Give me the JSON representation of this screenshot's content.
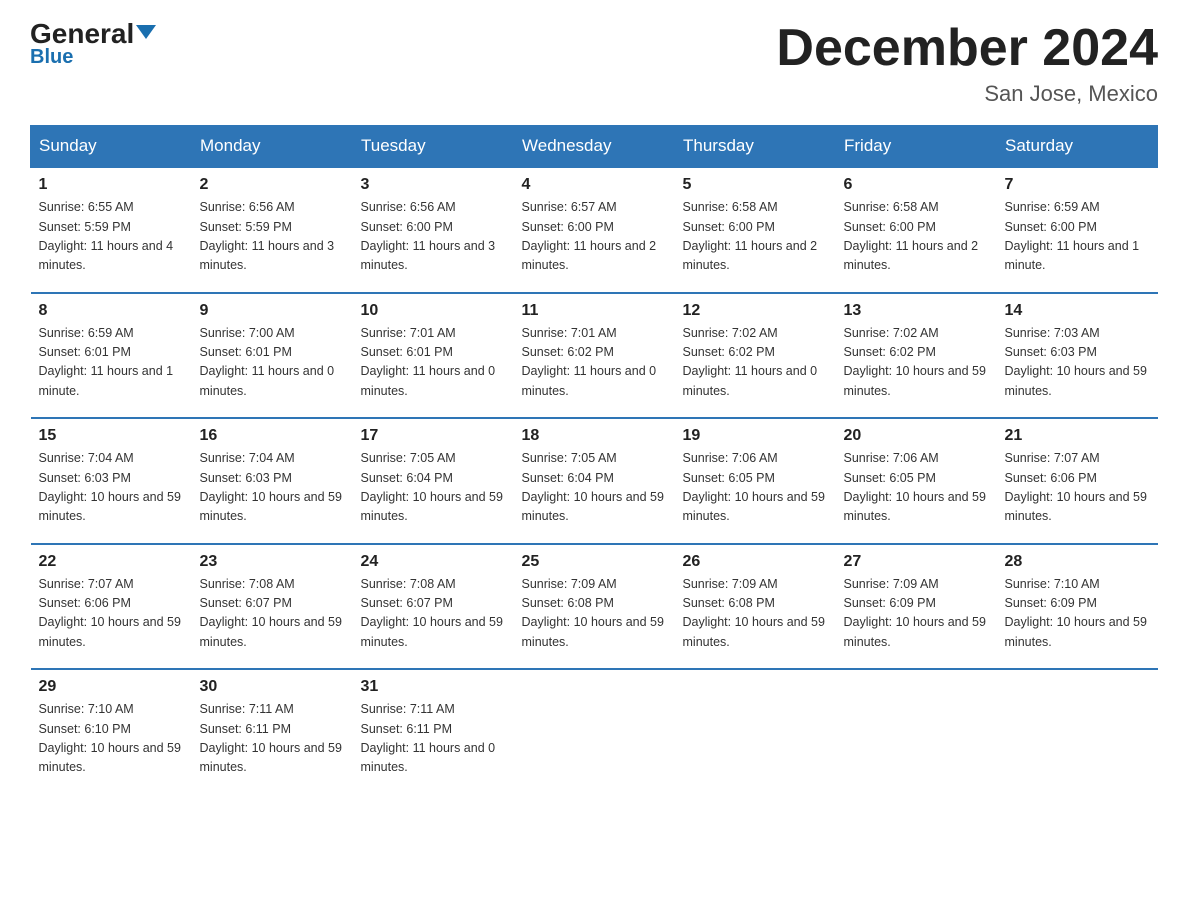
{
  "header": {
    "logo_general": "General",
    "logo_blue": "Blue",
    "month_title": "December 2024",
    "location": "San Jose, Mexico"
  },
  "weekdays": [
    "Sunday",
    "Monday",
    "Tuesday",
    "Wednesday",
    "Thursday",
    "Friday",
    "Saturday"
  ],
  "weeks": [
    [
      {
        "day": "1",
        "sunrise": "6:55 AM",
        "sunset": "5:59 PM",
        "daylight": "11 hours and 4 minutes."
      },
      {
        "day": "2",
        "sunrise": "6:56 AM",
        "sunset": "5:59 PM",
        "daylight": "11 hours and 3 minutes."
      },
      {
        "day": "3",
        "sunrise": "6:56 AM",
        "sunset": "6:00 PM",
        "daylight": "11 hours and 3 minutes."
      },
      {
        "day": "4",
        "sunrise": "6:57 AM",
        "sunset": "6:00 PM",
        "daylight": "11 hours and 2 minutes."
      },
      {
        "day": "5",
        "sunrise": "6:58 AM",
        "sunset": "6:00 PM",
        "daylight": "11 hours and 2 minutes."
      },
      {
        "day": "6",
        "sunrise": "6:58 AM",
        "sunset": "6:00 PM",
        "daylight": "11 hours and 2 minutes."
      },
      {
        "day": "7",
        "sunrise": "6:59 AM",
        "sunset": "6:00 PM",
        "daylight": "11 hours and 1 minute."
      }
    ],
    [
      {
        "day": "8",
        "sunrise": "6:59 AM",
        "sunset": "6:01 PM",
        "daylight": "11 hours and 1 minute."
      },
      {
        "day": "9",
        "sunrise": "7:00 AM",
        "sunset": "6:01 PM",
        "daylight": "11 hours and 0 minutes."
      },
      {
        "day": "10",
        "sunrise": "7:01 AM",
        "sunset": "6:01 PM",
        "daylight": "11 hours and 0 minutes."
      },
      {
        "day": "11",
        "sunrise": "7:01 AM",
        "sunset": "6:02 PM",
        "daylight": "11 hours and 0 minutes."
      },
      {
        "day": "12",
        "sunrise": "7:02 AM",
        "sunset": "6:02 PM",
        "daylight": "11 hours and 0 minutes."
      },
      {
        "day": "13",
        "sunrise": "7:02 AM",
        "sunset": "6:02 PM",
        "daylight": "10 hours and 59 minutes."
      },
      {
        "day": "14",
        "sunrise": "7:03 AM",
        "sunset": "6:03 PM",
        "daylight": "10 hours and 59 minutes."
      }
    ],
    [
      {
        "day": "15",
        "sunrise": "7:04 AM",
        "sunset": "6:03 PM",
        "daylight": "10 hours and 59 minutes."
      },
      {
        "day": "16",
        "sunrise": "7:04 AM",
        "sunset": "6:03 PM",
        "daylight": "10 hours and 59 minutes."
      },
      {
        "day": "17",
        "sunrise": "7:05 AM",
        "sunset": "6:04 PM",
        "daylight": "10 hours and 59 minutes."
      },
      {
        "day": "18",
        "sunrise": "7:05 AM",
        "sunset": "6:04 PM",
        "daylight": "10 hours and 59 minutes."
      },
      {
        "day": "19",
        "sunrise": "7:06 AM",
        "sunset": "6:05 PM",
        "daylight": "10 hours and 59 minutes."
      },
      {
        "day": "20",
        "sunrise": "7:06 AM",
        "sunset": "6:05 PM",
        "daylight": "10 hours and 59 minutes."
      },
      {
        "day": "21",
        "sunrise": "7:07 AM",
        "sunset": "6:06 PM",
        "daylight": "10 hours and 59 minutes."
      }
    ],
    [
      {
        "day": "22",
        "sunrise": "7:07 AM",
        "sunset": "6:06 PM",
        "daylight": "10 hours and 59 minutes."
      },
      {
        "day": "23",
        "sunrise": "7:08 AM",
        "sunset": "6:07 PM",
        "daylight": "10 hours and 59 minutes."
      },
      {
        "day": "24",
        "sunrise": "7:08 AM",
        "sunset": "6:07 PM",
        "daylight": "10 hours and 59 minutes."
      },
      {
        "day": "25",
        "sunrise": "7:09 AM",
        "sunset": "6:08 PM",
        "daylight": "10 hours and 59 minutes."
      },
      {
        "day": "26",
        "sunrise": "7:09 AM",
        "sunset": "6:08 PM",
        "daylight": "10 hours and 59 minutes."
      },
      {
        "day": "27",
        "sunrise": "7:09 AM",
        "sunset": "6:09 PM",
        "daylight": "10 hours and 59 minutes."
      },
      {
        "day": "28",
        "sunrise": "7:10 AM",
        "sunset": "6:09 PM",
        "daylight": "10 hours and 59 minutes."
      }
    ],
    [
      {
        "day": "29",
        "sunrise": "7:10 AM",
        "sunset": "6:10 PM",
        "daylight": "10 hours and 59 minutes."
      },
      {
        "day": "30",
        "sunrise": "7:11 AM",
        "sunset": "6:11 PM",
        "daylight": "10 hours and 59 minutes."
      },
      {
        "day": "31",
        "sunrise": "7:11 AM",
        "sunset": "6:11 PM",
        "daylight": "11 hours and 0 minutes."
      },
      null,
      null,
      null,
      null
    ]
  ]
}
